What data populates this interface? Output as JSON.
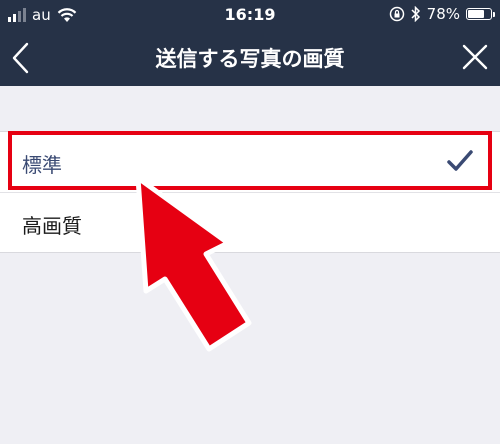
{
  "status_bar": {
    "carrier": "au",
    "time": "16:19",
    "battery_percent": "78%",
    "battery_level": 0.78,
    "signal_bars_active": 2,
    "signal_bars_total": 4
  },
  "navbar": {
    "title": "送信する写真の画質",
    "back_icon": "chevron-left-icon",
    "close_icon": "close-icon"
  },
  "options": [
    {
      "label": "標準",
      "selected": true
    },
    {
      "label": "高画質",
      "selected": false
    }
  ],
  "colors": {
    "navbar_bg": "#263247",
    "page_bg": "#efeff4",
    "highlight": "#e60012",
    "check": "#3a4a73"
  }
}
